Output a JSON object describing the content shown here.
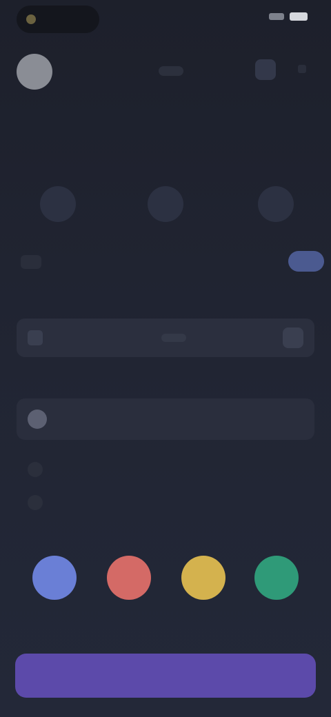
{
  "status_bar": {
    "time": "",
    "pill_text": ""
  },
  "header": {
    "title": ""
  },
  "section": {
    "title": ""
  },
  "stats": [
    {
      "label": ""
    },
    {
      "label": ""
    },
    {
      "label": ""
    }
  ],
  "summary": {
    "value": "",
    "subtitle": ""
  },
  "field": {
    "label": "",
    "value": ""
  },
  "options": {
    "label": "",
    "selected": ""
  },
  "list_items": [
    {
      "label": ""
    },
    {
      "label": ""
    }
  ],
  "colors": [
    {
      "name": "",
      "hex": "#6a7fd6"
    },
    {
      "name": "",
      "hex": "#d46a66"
    },
    {
      "name": "",
      "hex": "#d4b24e"
    },
    {
      "name": "",
      "hex": "#2f9a78"
    }
  ],
  "primary_button": {
    "label": ""
  },
  "theme": {
    "accent": "#5c4aaa",
    "background": "#212533"
  }
}
